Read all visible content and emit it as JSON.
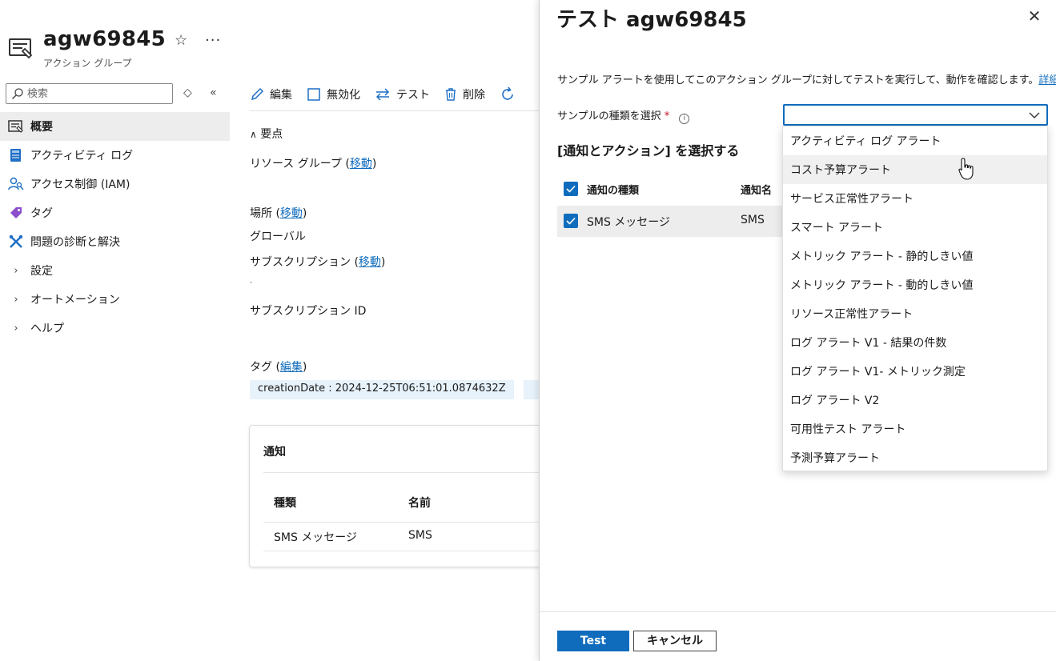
{
  "resource": {
    "title": "agw69845",
    "subtitle": "アクション グループ",
    "star_icon": "star-icon",
    "more_label": "···"
  },
  "leftnav": {
    "search_placeholder": "検索",
    "items": [
      {
        "label": "概要",
        "icon": "overview-icon",
        "active": true
      },
      {
        "label": "アクティビティ ログ",
        "icon": "activity-log-icon"
      },
      {
        "label": "アクセス制御 (IAM)",
        "icon": "iam-icon"
      },
      {
        "label": "タグ",
        "icon": "tag-icon"
      },
      {
        "label": "問題の診断と解決",
        "icon": "wrench-icon"
      },
      {
        "label": "設定",
        "icon": "chevron-right-icon"
      },
      {
        "label": "オートメーション",
        "icon": "chevron-right-icon"
      },
      {
        "label": "ヘルプ",
        "icon": "chevron-right-icon"
      }
    ]
  },
  "toolbar": {
    "edit": "編集",
    "disable": "無効化",
    "test": "テスト",
    "delete": "削除"
  },
  "essentials": {
    "toggle": "要点",
    "resource_group_label": "リソース グループ",
    "move_link": "移動",
    "location_label": "場所",
    "location_value": "グローバル",
    "subscription_label": "サブスクリプション",
    "subscription_value": "-",
    "subscription_id_label": "サブスクリプション ID",
    "tags_label": "タグ",
    "edit_link": "編集",
    "tag_value": "creationDate : 2024-12-25T06:51:01.0874632Z"
  },
  "notifications_card": {
    "title": "通知",
    "col_type": "種類",
    "col_name": "名前",
    "row_type": "SMS メッセージ",
    "row_name": "SMS"
  },
  "panel": {
    "title": "テスト agw69845",
    "description": "サンプル アラートを使用してこのアクション グループに対してテストを実行して、動作を確認します。",
    "learn_more": "詳細情報",
    "sample_label": "サンプルの種類を選択",
    "required_mark": "*",
    "info_glyph": "i",
    "section_title": "[通知とアクション] を選択する",
    "grid_col_type": "通知の種類",
    "grid_col_name": "通知名",
    "grid_row_type": "SMS メッセージ",
    "grid_row_name": "SMS",
    "test_button": "Test",
    "cancel_button": "キャンセル"
  },
  "dropdown_options": [
    "アクティビティ ログ アラート",
    "コスト予算アラート",
    "サービス正常性アラート",
    "スマート アラート",
    "メトリック アラート - 静的しきい値",
    "メトリック アラート - 動的しきい値",
    "リソース正常性アラート",
    "ログ アラート V1 - 結果の件数",
    "ログ アラート V1- メトリック測定",
    "ログ アラート V2",
    "可用性テスト アラート",
    "予測予算アラート"
  ],
  "dropdown_hover_index": 1,
  "colors": {
    "accent": "#0f6cbd",
    "active_bg": "#ededed",
    "tag_bg": "#e7f2fb",
    "required": "#c50f1f"
  }
}
